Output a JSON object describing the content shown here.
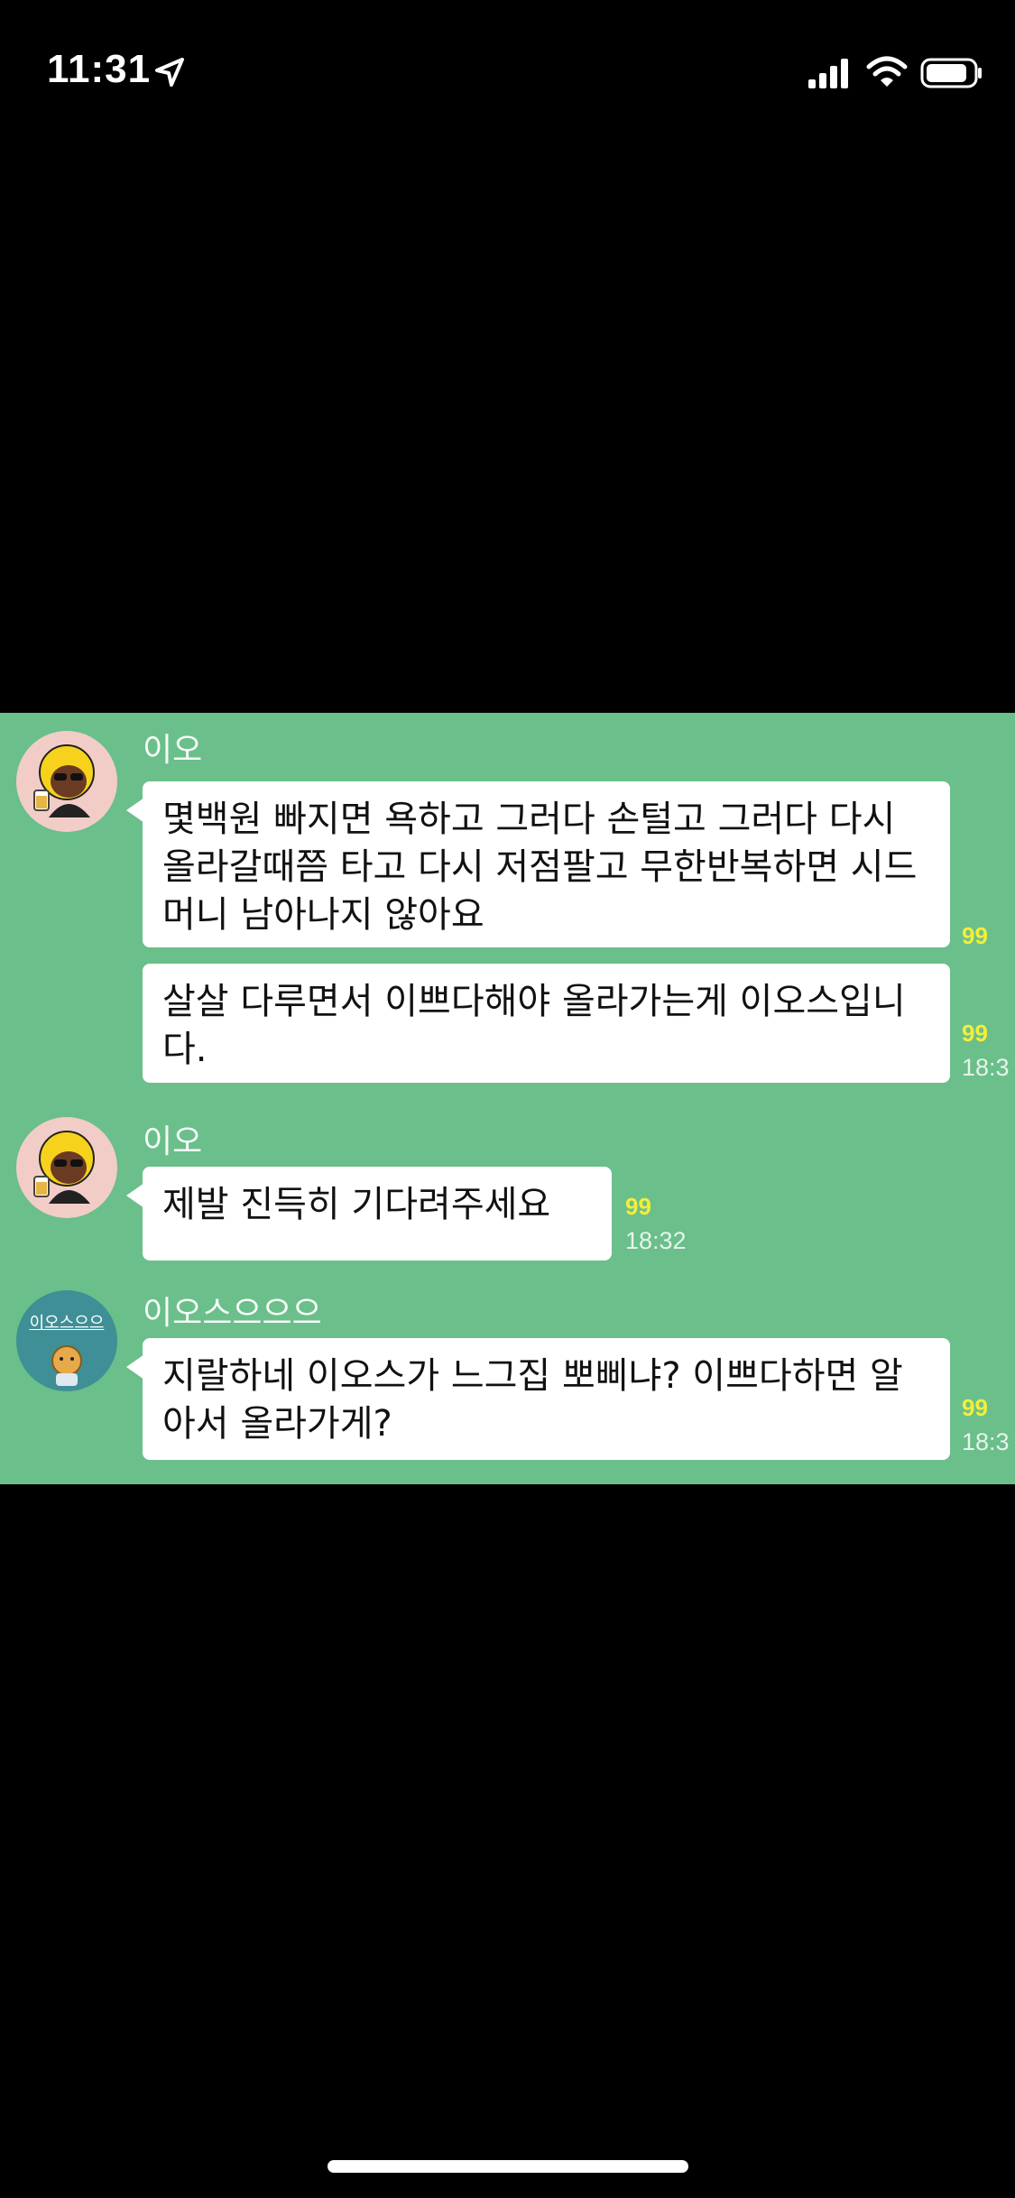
{
  "status_bar": {
    "time": "11:31",
    "icons": [
      "location-arrow-icon",
      "cellular-signal-icon",
      "wifi-icon",
      "battery-icon"
    ]
  },
  "chat": {
    "background_color": "#6abf8a",
    "messages": [
      {
        "sender": "이오",
        "text": "몇백원 빠지면 욕하고 그러다 손털고 그러다 다시 올라갈때쯤 타고 다시 저점팔고 무한반복하면 시드머니 남아나지 않아요",
        "unread": "99",
        "time": ""
      },
      {
        "sender": "",
        "text": "살살 다루면서 이쁘다해야 올라가는게 이오스입니다.",
        "unread": "99",
        "time": "18:3"
      },
      {
        "sender": "이오",
        "text": "제발 진득히 기다려주세요",
        "unread": "99",
        "time": "18:32"
      },
      {
        "sender": "이오스으으으",
        "text": "지랄하네 이오스가 느그집 뽀삐냐? 이쁘다하면 알아서 올라가게?",
        "unread": "99",
        "time": "18:3"
      }
    ],
    "avatar_label": "이오스으으"
  }
}
